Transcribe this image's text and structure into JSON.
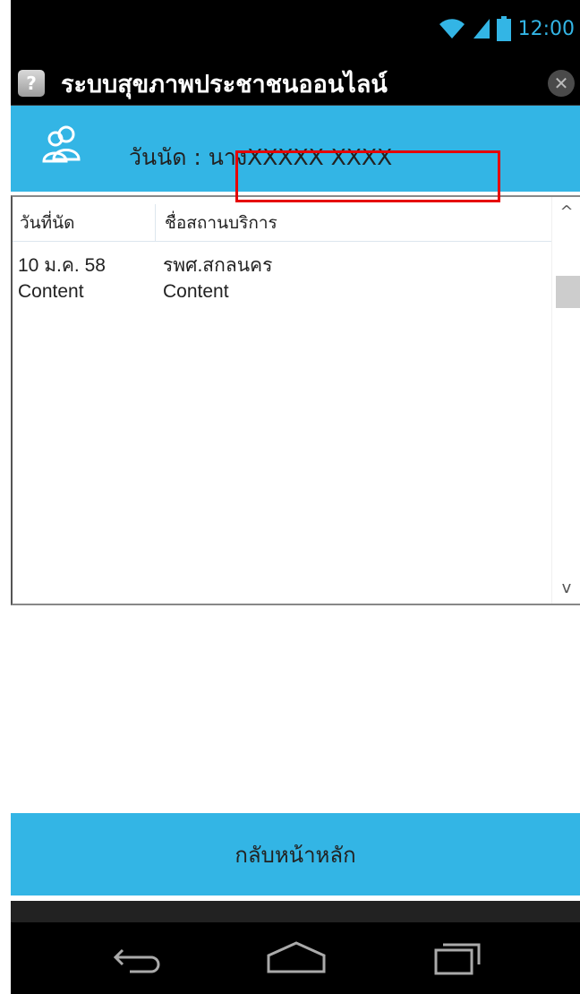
{
  "status_bar": {
    "time": "12:00",
    "icons": [
      "wifi-icon",
      "signal-icon",
      "battery-icon"
    ],
    "accent_color": "#33b5e5"
  },
  "app": {
    "title": "ระบบสุขภาพประชาชนออนไลน์",
    "help_icon_glyph": "?",
    "close_icon_glyph": "✕"
  },
  "header": {
    "title": "วันนัด : นางXXXXX   XXXX",
    "icon": "users-icon",
    "background_color": "#33b5e5"
  },
  "table": {
    "columns": [
      "วันที่นัด",
      "ชื่อสถานบริการ"
    ],
    "rows": [
      [
        "10 ม.ค. 58",
        "รพศ.สกลนคร"
      ],
      [
        "Content",
        "Content"
      ]
    ],
    "scroll_up_glyph": "^",
    "scroll_down_glyph": "v"
  },
  "footer": {
    "back_label": "กลับหน้าหลัก"
  },
  "nav_bar": {
    "buttons": [
      "back-icon",
      "home-icon",
      "recent-apps-icon"
    ]
  },
  "annotation": {
    "highlight_color": "#e60000"
  }
}
